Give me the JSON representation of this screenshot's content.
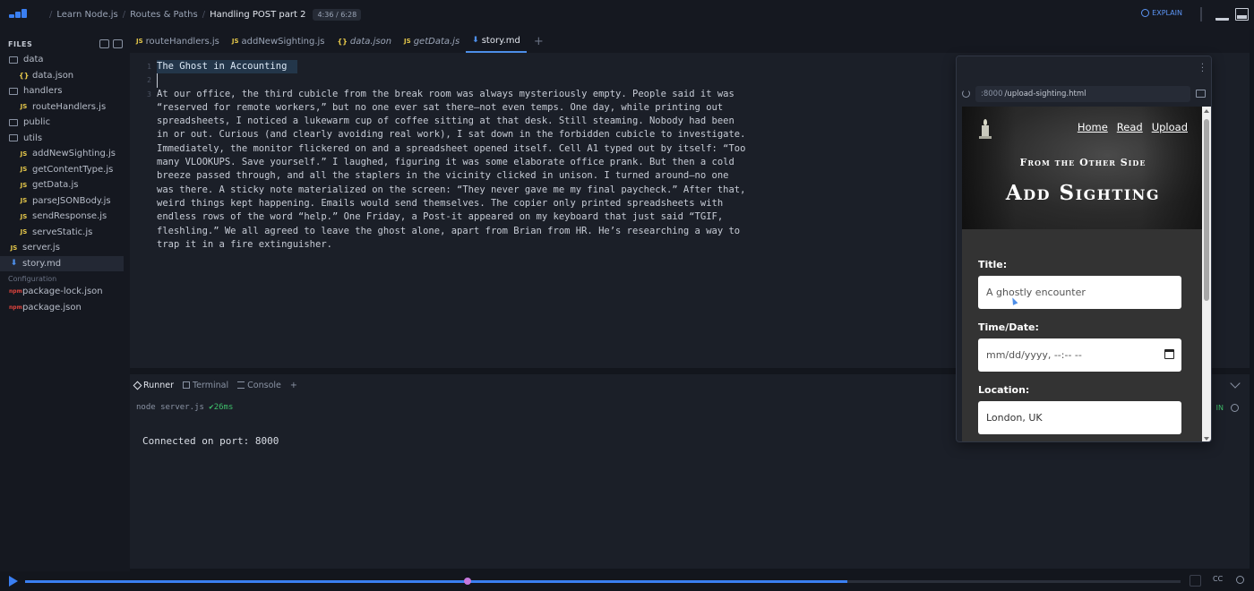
{
  "topbar": {
    "breadcrumbs": [
      "Learn Node.js",
      "Routes & Paths",
      "Handling POST part 2"
    ],
    "time": "4:36 / 6:28",
    "explain_label": "EXPLAIN"
  },
  "sidebar": {
    "title": "FILES",
    "items": [
      {
        "label": "data",
        "type": "folder",
        "depth": 0
      },
      {
        "label": "data.json",
        "type": "json",
        "depth": 1
      },
      {
        "label": "handlers",
        "type": "folder",
        "depth": 0
      },
      {
        "label": "routeHandlers.js",
        "type": "js",
        "depth": 1
      },
      {
        "label": "public",
        "type": "folder",
        "depth": 0
      },
      {
        "label": "utils",
        "type": "folder",
        "depth": 0
      },
      {
        "label": "addNewSighting.js",
        "type": "js",
        "depth": 1
      },
      {
        "label": "getContentType.js",
        "type": "js",
        "depth": 1
      },
      {
        "label": "getData.js",
        "type": "js",
        "depth": 1
      },
      {
        "label": "parseJSONBody.js",
        "type": "js",
        "depth": 1
      },
      {
        "label": "sendResponse.js",
        "type": "js",
        "depth": 1
      },
      {
        "label": "serveStatic.js",
        "type": "js",
        "depth": 1
      },
      {
        "label": "server.js",
        "type": "js",
        "depth": 0
      },
      {
        "label": "story.md",
        "type": "md",
        "depth": 0,
        "active": true
      }
    ],
    "config_label": "Configuration",
    "config_items": [
      {
        "label": "package-lock.json",
        "type": "npm"
      },
      {
        "label": "package.json",
        "type": "npm"
      }
    ]
  },
  "editor": {
    "tabs": [
      {
        "label": "routeHandlers.js",
        "type": "js",
        "italic": false
      },
      {
        "label": "addNewSighting.js",
        "type": "js",
        "italic": false
      },
      {
        "label": "data.json",
        "type": "json",
        "italic": true
      },
      {
        "label": "getData.js",
        "type": "js",
        "italic": true
      },
      {
        "label": "story.md",
        "type": "md",
        "italic": false,
        "active": true
      }
    ],
    "line_numbers": [
      "1",
      "2",
      "3"
    ],
    "line1": "The Ghost in Accounting",
    "paragraph": "At our office, the third cubicle from the break room was always mysteriously empty. People said it was “reserved for remote workers,” but no one ever sat there—not even temps. One day, while printing out spreadsheets, I noticed a lukewarm cup of coffee sitting at that desk. Still steaming. Nobody had been in or out. Curious (and clearly avoiding real work), I sat down in the forbidden cubicle to investigate. Immediately, the monitor flickered on and a spreadsheet opened itself. Cell A1 typed out by itself: “Too many VLOOKUPS. Save yourself.” I laughed, figuring it was some elaborate office prank. But then a cold breeze passed through, and all the staplers in the vicinity clicked in unison. I turned around—no one was there. A sticky note materialized on the screen: “They never gave me my final paycheck.” After that, weird things kept happening. Emails would send themselves. The copier only printed spreadsheets with endless rows of the word “help.” One Friday, a Post-it appeared on my keyboard that just said “TGIF, fleshling.” We all agreed to leave the ghost alone, apart from Brian from HR. He’s researching a way to trap it in a fire extinguisher."
  },
  "runner": {
    "tabs": [
      "Runner",
      "Terminal",
      "Console"
    ],
    "command": "node server.js",
    "duration": "26ms",
    "output": "Connected on port: 8000",
    "status_partial": "IN"
  },
  "preview": {
    "url_port": ":8000",
    "url_path": "/upload-sighting.html",
    "nav": [
      "Home",
      "Read",
      "Upload"
    ],
    "subtitle": "From the Other Side",
    "title": "Add Sighting",
    "fields": [
      {
        "label": "Title:",
        "placeholder": "A ghostly encounter"
      },
      {
        "label": "Time/Date:",
        "placeholder": "mm/dd/yyyy, --:-- --"
      },
      {
        "label": "Location:",
        "value": "London, UK"
      }
    ]
  },
  "player": {
    "progress": 0.712,
    "knob_position": 0.383,
    "cc_label": "CC"
  }
}
